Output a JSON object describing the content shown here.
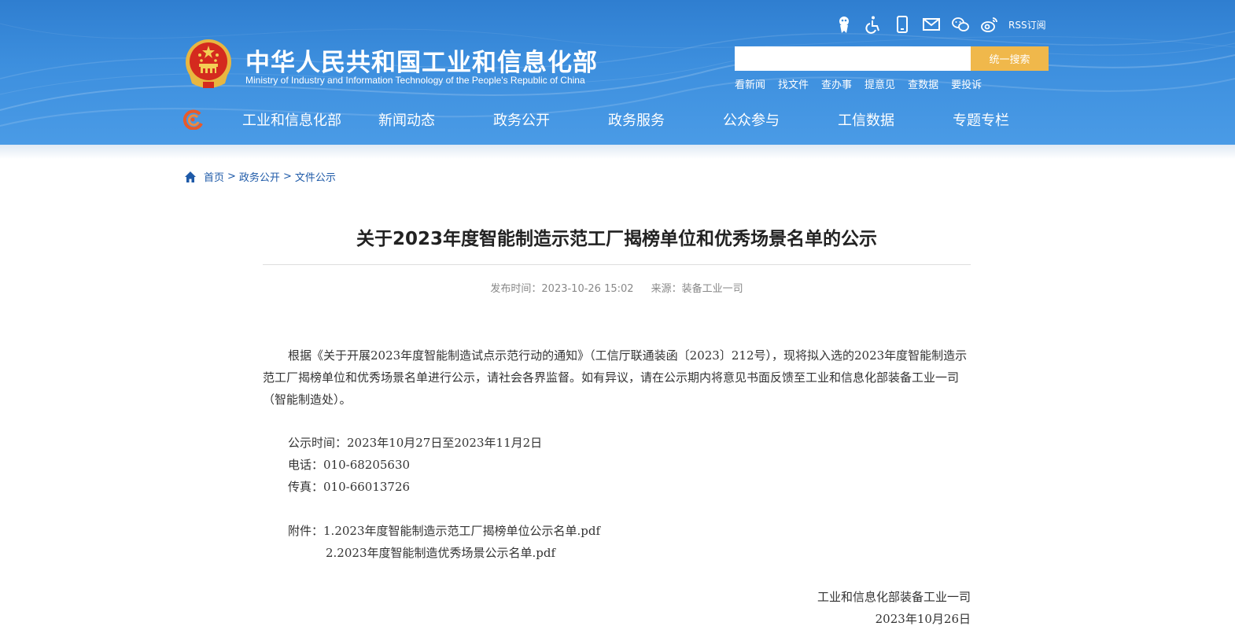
{
  "header": {
    "site_title": "中华人民共和国工业和信息化部",
    "site_subtitle": "Ministry of Industry and Information Technology of the People's Republic of China",
    "emblem_icon": "national-emblem-icon",
    "util_icons": [
      "search-robot-icon",
      "accessibility-icon",
      "mobile-icon",
      "mail-icon",
      "wechat-icon",
      "weibo-icon"
    ],
    "rss_label": "RSS订阅",
    "search": {
      "placeholder": "",
      "button_label": "统一搜索"
    },
    "quick_links": [
      "看新闻",
      "找文件",
      "查办事",
      "提意见",
      "查数据",
      "要投诉"
    ],
    "nav": [
      "工业和信息化部",
      "新闻动态",
      "政务公开",
      "政务服务",
      "公众参与",
      "工信数据",
      "专题专栏"
    ],
    "colors": {
      "header_blue": "#3a8ad8",
      "search_button": "#f0b84b",
      "link_blue": "#1e5aa8"
    }
  },
  "breadcrumb": {
    "items": [
      "首页",
      "政务公开",
      "文件公示"
    ],
    "separator": ">"
  },
  "article": {
    "title": "关于2023年度智能制造示范工厂揭榜单位和优秀场景名单的公示",
    "publish_time_label": "发布时间：2023-10-26 15:02",
    "source_label": "来源：装备工业一司",
    "paragraph": "根据《关于开展2023年度智能制造试点示范行动的通知》（工信厅联通装函〔2023〕212号），现将拟入选的2023年度智能制造示范工厂揭榜单位和优秀场景名单进行公示，请社会各界监督。如有异议，请在公示期内将意见书面反馈至工业和信息化部装备工业一司（智能制造处）。",
    "period": "公示时间：2023年10月27日至2023年11月2日",
    "phone": "电话：010-68205630",
    "fax": "传真：010-66013726",
    "attachments_label": "附件：",
    "attachments": [
      "1.2023年度智能制造示范工厂揭榜单位公示名单.pdf",
      "2.2023年度智能制造优秀场景公示名单.pdf"
    ],
    "signature": "工业和信息化部装备工业一司",
    "date": "2023年10月26日"
  }
}
